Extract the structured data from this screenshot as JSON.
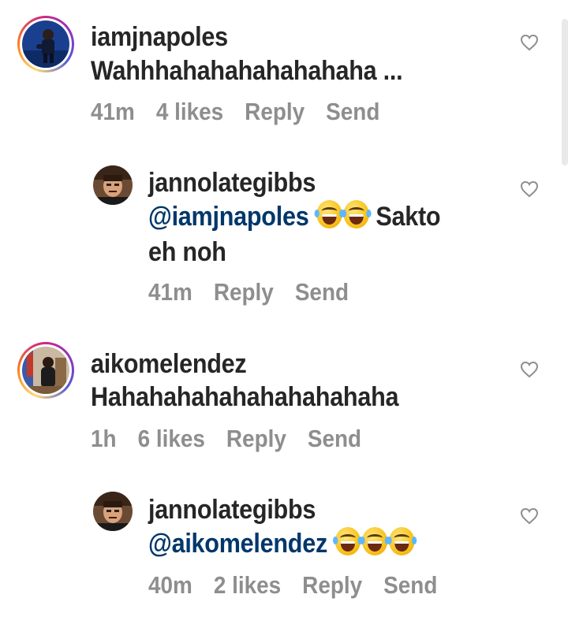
{
  "comments": [
    {
      "username": "iamjnapoles",
      "text": "Wahhhahahahahahahaha ...",
      "time": "41m",
      "likes": "4 likes",
      "reply": "Reply",
      "send": "Send"
    },
    {
      "username": "jannolategibbs",
      "mention": "@iamjnapoles",
      "text_after": "Sakto",
      "text_line2": "eh noh",
      "time": "41m",
      "reply": "Reply",
      "send": "Send"
    },
    {
      "username": "aikomelendez",
      "text": "Hahahahahahahahahahaha",
      "time": "1h",
      "likes": "6 likes",
      "reply": "Reply",
      "send": "Send"
    },
    {
      "username": "jannolategibbs",
      "mention": "@aikomelendez",
      "time": "40m",
      "likes": "2 likes",
      "reply": "Reply",
      "send": "Send"
    }
  ],
  "icons": {
    "like": "heart-outline-icon",
    "emoji": "face-with-tears-of-joy"
  },
  "colors": {
    "text": "#262626",
    "meta": "#8e8e8e",
    "mention": "#00376b"
  }
}
